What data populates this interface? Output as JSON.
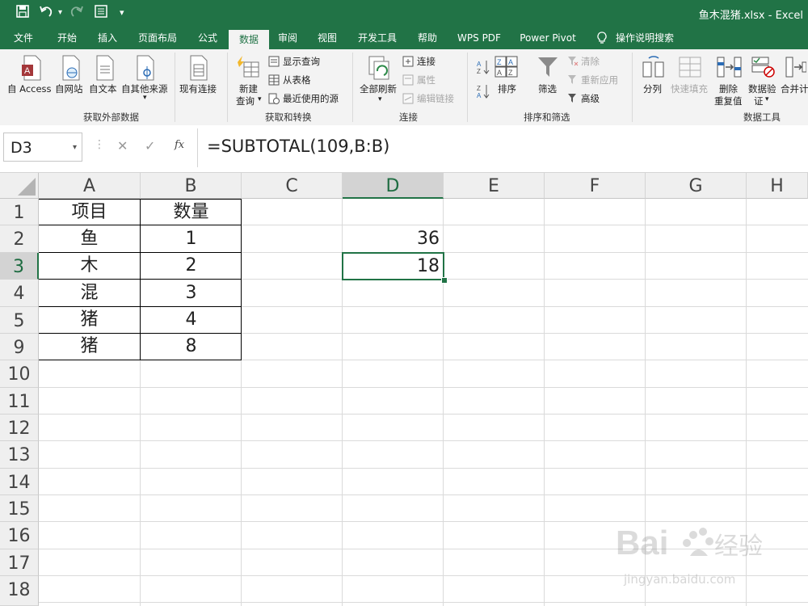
{
  "window": {
    "title": "鱼木混猪.xlsx  -  Excel"
  },
  "tabs": [
    {
      "label": "文件"
    },
    {
      "label": "开始"
    },
    {
      "label": "插入"
    },
    {
      "label": "页面布局"
    },
    {
      "label": "公式"
    },
    {
      "label": "数据"
    },
    {
      "label": "审阅"
    },
    {
      "label": "视图"
    },
    {
      "label": "开发工具"
    },
    {
      "label": "帮助"
    },
    {
      "label": "WPS PDF"
    },
    {
      "label": "Power Pivot"
    },
    {
      "label": "操作说明搜索"
    }
  ],
  "ribbon": {
    "get_external": {
      "group_label": "获取外部数据",
      "access": "自 Access",
      "web": "自网站",
      "text": "自文本",
      "other": "自其他来源",
      "existing": "现有连接"
    },
    "transform": {
      "group_label": "获取和转换",
      "new_query_1": "新建",
      "new_query_2": "查询",
      "show_queries": "显示查询",
      "from_table": "从表格",
      "recent_sources": "最近使用的源"
    },
    "connections": {
      "group_label": "连接",
      "refresh_all": "全部刷新",
      "connections": "连接",
      "properties": "属性",
      "edit_links": "编辑链接"
    },
    "sort_filter": {
      "group_label": "排序和筛选",
      "sort": "排序",
      "filter": "筛选",
      "clear": "清除",
      "reapply": "重新应用",
      "advanced": "高级"
    },
    "data_tools": {
      "group_label": "数据工具",
      "text_to_columns": "分列",
      "flash_fill": "快速填充",
      "remove_dup_1": "删除",
      "remove_dup_2": "重复值",
      "validation_1": "数据验",
      "validation_2": "证",
      "consolidate": "合并计"
    }
  },
  "formula_bar": {
    "name_box": "D3",
    "cancel": "✕",
    "enter": "✓",
    "fx": "fx",
    "formula": "=SUBTOTAL(109,B:B)"
  },
  "columns": [
    "A",
    "B",
    "C",
    "D",
    "E",
    "F",
    "G",
    "H"
  ],
  "rows": [
    "1",
    "2",
    "3",
    "4",
    "5",
    "9",
    "10",
    "11",
    "12",
    "13",
    "14",
    "15",
    "16",
    "17",
    "18"
  ],
  "cells": {
    "A1": "项目",
    "B1": "数量",
    "A2": "鱼",
    "B2": "1",
    "D2": "36",
    "A3": "木",
    "B3": "2",
    "D3": "18",
    "A4": "混",
    "B4": "3",
    "A5": "猪",
    "B5": "4",
    "A9": "猪",
    "B9": "8"
  },
  "watermark": {
    "text": "jingyan.baidu.com"
  },
  "colors": {
    "accent": "#217346"
  }
}
